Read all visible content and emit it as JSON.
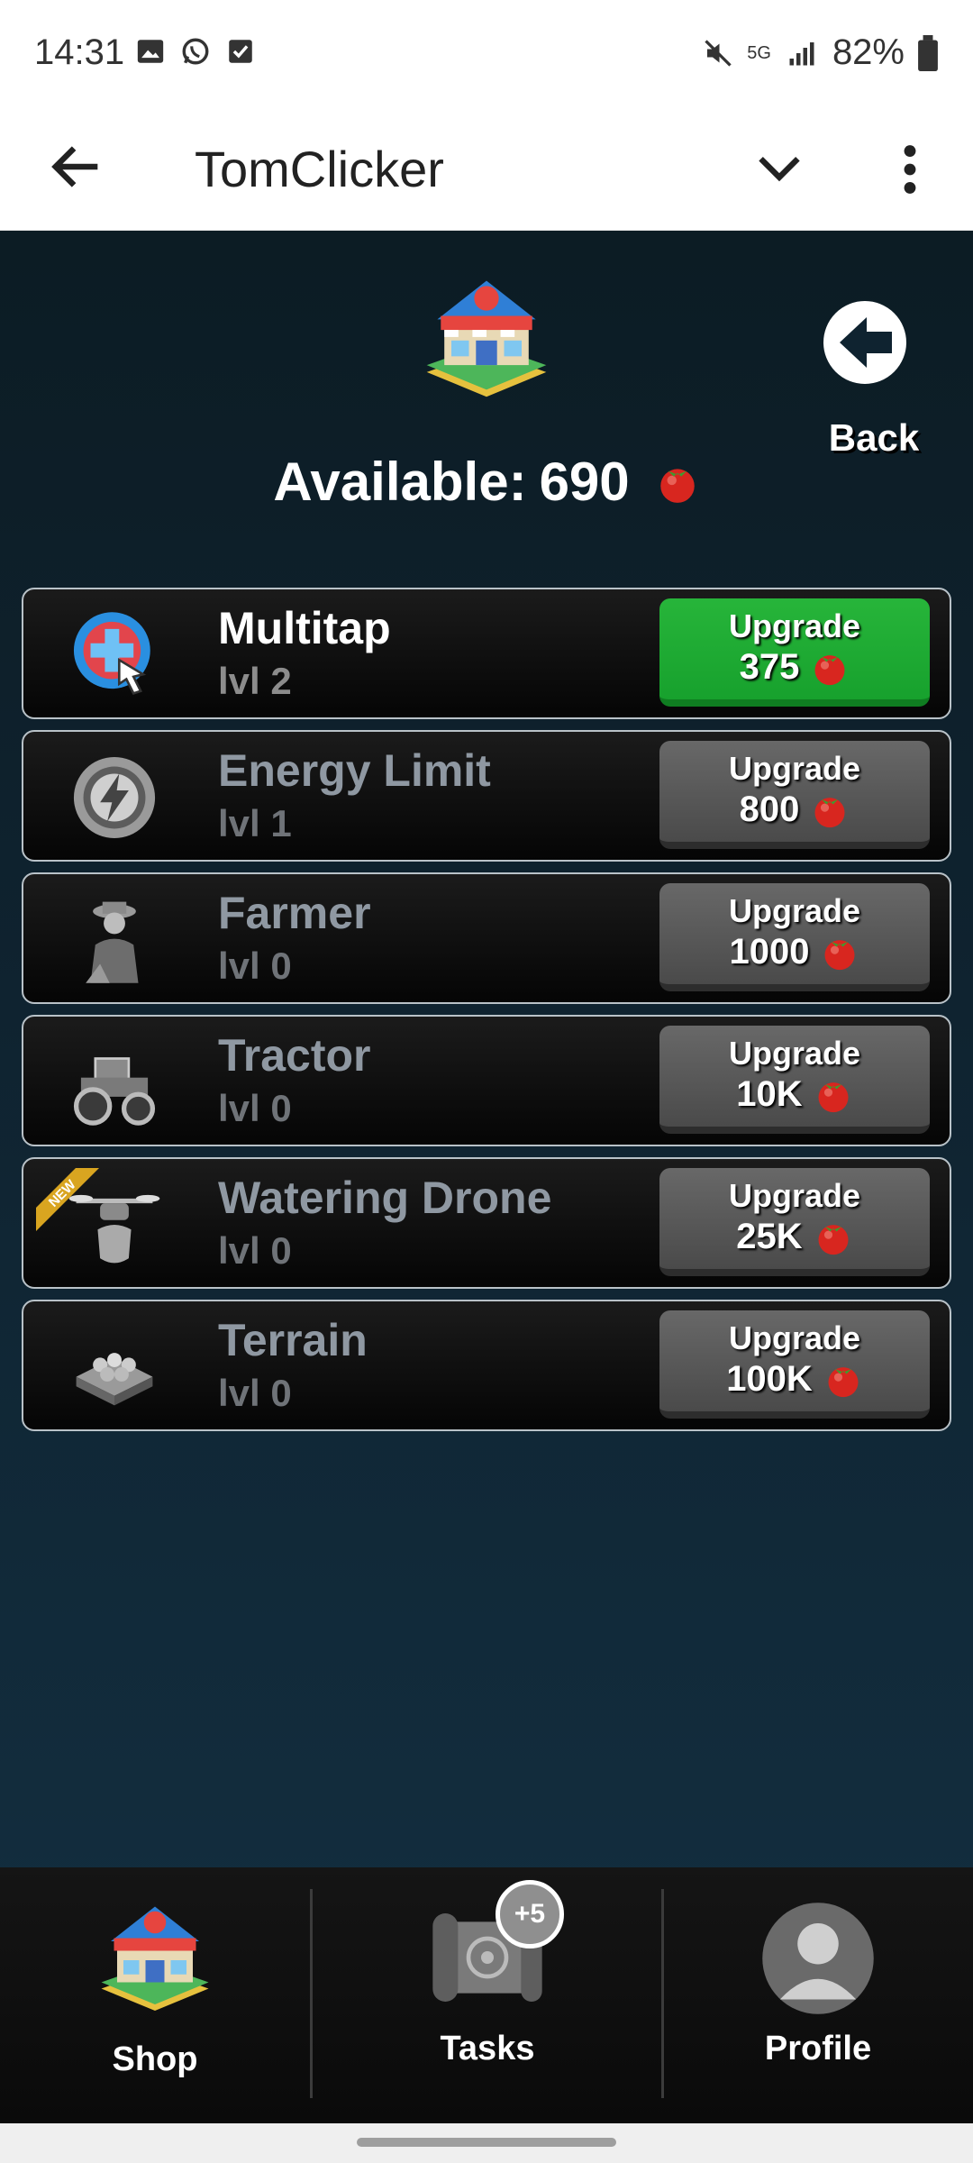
{
  "status_bar": {
    "time": "14:31",
    "battery": "82%",
    "network": "5G"
  },
  "app_bar": {
    "title": "TomClicker"
  },
  "header": {
    "back_label": "Back",
    "available_label": "Available:",
    "available_value": "690"
  },
  "upgrades": [
    {
      "name": "Multitap",
      "level": "lvl 2",
      "button_label": "Upgrade",
      "cost": "375",
      "affordable": true,
      "icon": "multitap-icon"
    },
    {
      "name": "Energy Limit",
      "level": "lvl 1",
      "button_label": "Upgrade",
      "cost": "800",
      "affordable": false,
      "icon": "energy-icon"
    },
    {
      "name": "Farmer",
      "level": "lvl 0",
      "button_label": "Upgrade",
      "cost": "1000",
      "affordable": false,
      "icon": "farmer-icon"
    },
    {
      "name": "Tractor",
      "level": "lvl 0",
      "button_label": "Upgrade",
      "cost": "10K",
      "affordable": false,
      "icon": "tractor-icon"
    },
    {
      "name": "Watering Drone",
      "level": "lvl 0",
      "button_label": "Upgrade",
      "cost": "25K",
      "affordable": false,
      "icon": "drone-icon",
      "badge": "NEW"
    },
    {
      "name": "Terrain",
      "level": "lvl 0",
      "button_label": "Upgrade",
      "cost": "100K",
      "affordable": false,
      "icon": "terrain-icon"
    }
  ],
  "bottom_nav": {
    "shop": "Shop",
    "tasks": "Tasks",
    "tasks_badge": "+5",
    "profile": "Profile"
  },
  "colors": {
    "affordable": "#1ea834",
    "locked": "#5a5a5a",
    "background": "#0f2330"
  }
}
